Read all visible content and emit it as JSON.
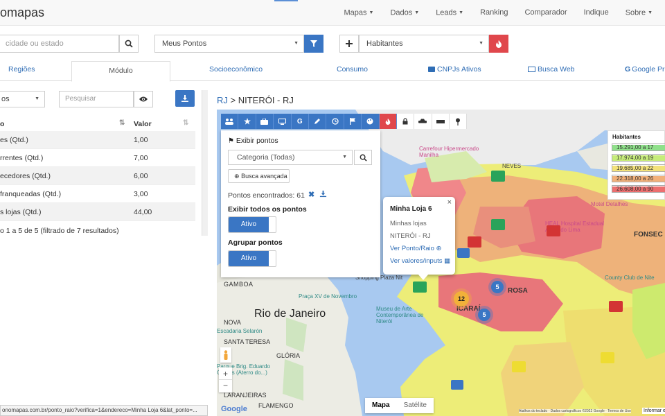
{
  "nav": {
    "brand": "omapas",
    "items": [
      {
        "label": "Mapas",
        "caret": true
      },
      {
        "label": "Dados",
        "caret": true
      },
      {
        "label": "Leads",
        "caret": true
      },
      {
        "label": "Ranking",
        "caret": false
      },
      {
        "label": "Comparador",
        "caret": false
      },
      {
        "label": "Indique",
        "caret": false
      },
      {
        "label": "Sobre",
        "caret": true
      }
    ]
  },
  "controls": {
    "location_placeholder": "cidade ou estado",
    "points_select": "Meus Pontos",
    "indicator_select": "Habitantes"
  },
  "tabs": {
    "regioes": "Regiões",
    "modulo": "Módulo",
    "socio": "Socioeconômico",
    "consumo": "Consumo",
    "cnpjs": "CNPJs Ativos",
    "busca_web": "Busca Web",
    "google": "Google Pro"
  },
  "left": {
    "select_value": "os",
    "search_placeholder": "Pesquisar",
    "col_name": "o",
    "col_value": "Valor",
    "rows": [
      {
        "name": "es (Qtd.)",
        "value": "1,00"
      },
      {
        "name": "rrentes (Qtd.)",
        "value": "7,00"
      },
      {
        "name": "ecedores (Qtd.)",
        "value": "6,00"
      },
      {
        "name": "franqueadas (Qtd.)",
        "value": "3,00"
      },
      {
        "name": "s lojas (Qtd.)",
        "value": "44,00"
      }
    ],
    "footer": "o 1 a 5 de 5 (filtrado de 7 resultados)"
  },
  "breadcrumb": {
    "link": "RJ",
    "separator": " > ",
    "current": "NITERÓI - RJ"
  },
  "panel": {
    "title": "Exibir pontos",
    "category": "Categoria (Todas)",
    "advanced": "Busca avançada",
    "found_label": "Pontos encontrados: 61",
    "show_all_label": "Exibir todos os pontos",
    "show_all_state": "Ativo",
    "group_label": "Agrupar pontos",
    "group_state": "Ativo"
  },
  "popup": {
    "title": "Minha Loja 6",
    "line1": "Minhas lojas",
    "line2": "NITERÓI - RJ",
    "link1": "Ver Ponto/Raio",
    "link2": "Ver valores/inputs"
  },
  "legend": {
    "title": "Habitantes",
    "rows": [
      {
        "label": "15.291,00 a 17",
        "color": "#8fe08a"
      },
      {
        "label": "17.974,00 a 19",
        "color": "#c6ec7a"
      },
      {
        "label": "19.685,00 a 22",
        "color": "#f3e27a"
      },
      {
        "label": "22.318,00 a 26",
        "color": "#f2b07a"
      },
      {
        "label": "26.608,00 a 90",
        "color": "#ec6f6f"
      }
    ]
  },
  "map": {
    "label_rio": "Rio de Janeiro",
    "label_gamboa": "GAMBOA",
    "label_nova": "NOVA",
    "label_santa_teresa": "SANTA TERESA",
    "label_gloria": "GLÓRIA",
    "label_laranjeiras": "LARANJEIRAS",
    "label_flamengo": "FLAMENGO",
    "label_icarai": "ICARAÍ",
    "label_rosa": "ROSA",
    "label_fonseca": "FONSEC",
    "label_neves": "NEVES",
    "label_carrefour": "Carrefour Hipermercado Manilha",
    "label_heal": "HEAL Hospital Estadual Azevedo Lima",
    "label_praca": "Praça XV de Novembro",
    "label_museu": "Museu de Arte Contemporânea de Niterói",
    "label_escadaria": "Escadaria Selarón",
    "label_parque": "Parque Brig. Eduardo Gomes (Aterro do...)",
    "label_country": "County Club de Nite",
    "label_shopping": "Shopping Plaza Nit",
    "label_motel": "Motel Detalhes",
    "cluster_12": "12",
    "cluster_5a": "5",
    "cluster_5b": "5",
    "map_type_map": "Mapa",
    "map_type_sat": "Satélite",
    "google": "Google",
    "attribution": "Atalhos do teclado · Dados cartográficos ©2022 Google · Termos de Uso",
    "report": "Informar e"
  },
  "status_url": "onomapas.com.br/ponto_raio?verifica=1&endereco=Minha Loja 6&lat_ponto=..."
}
